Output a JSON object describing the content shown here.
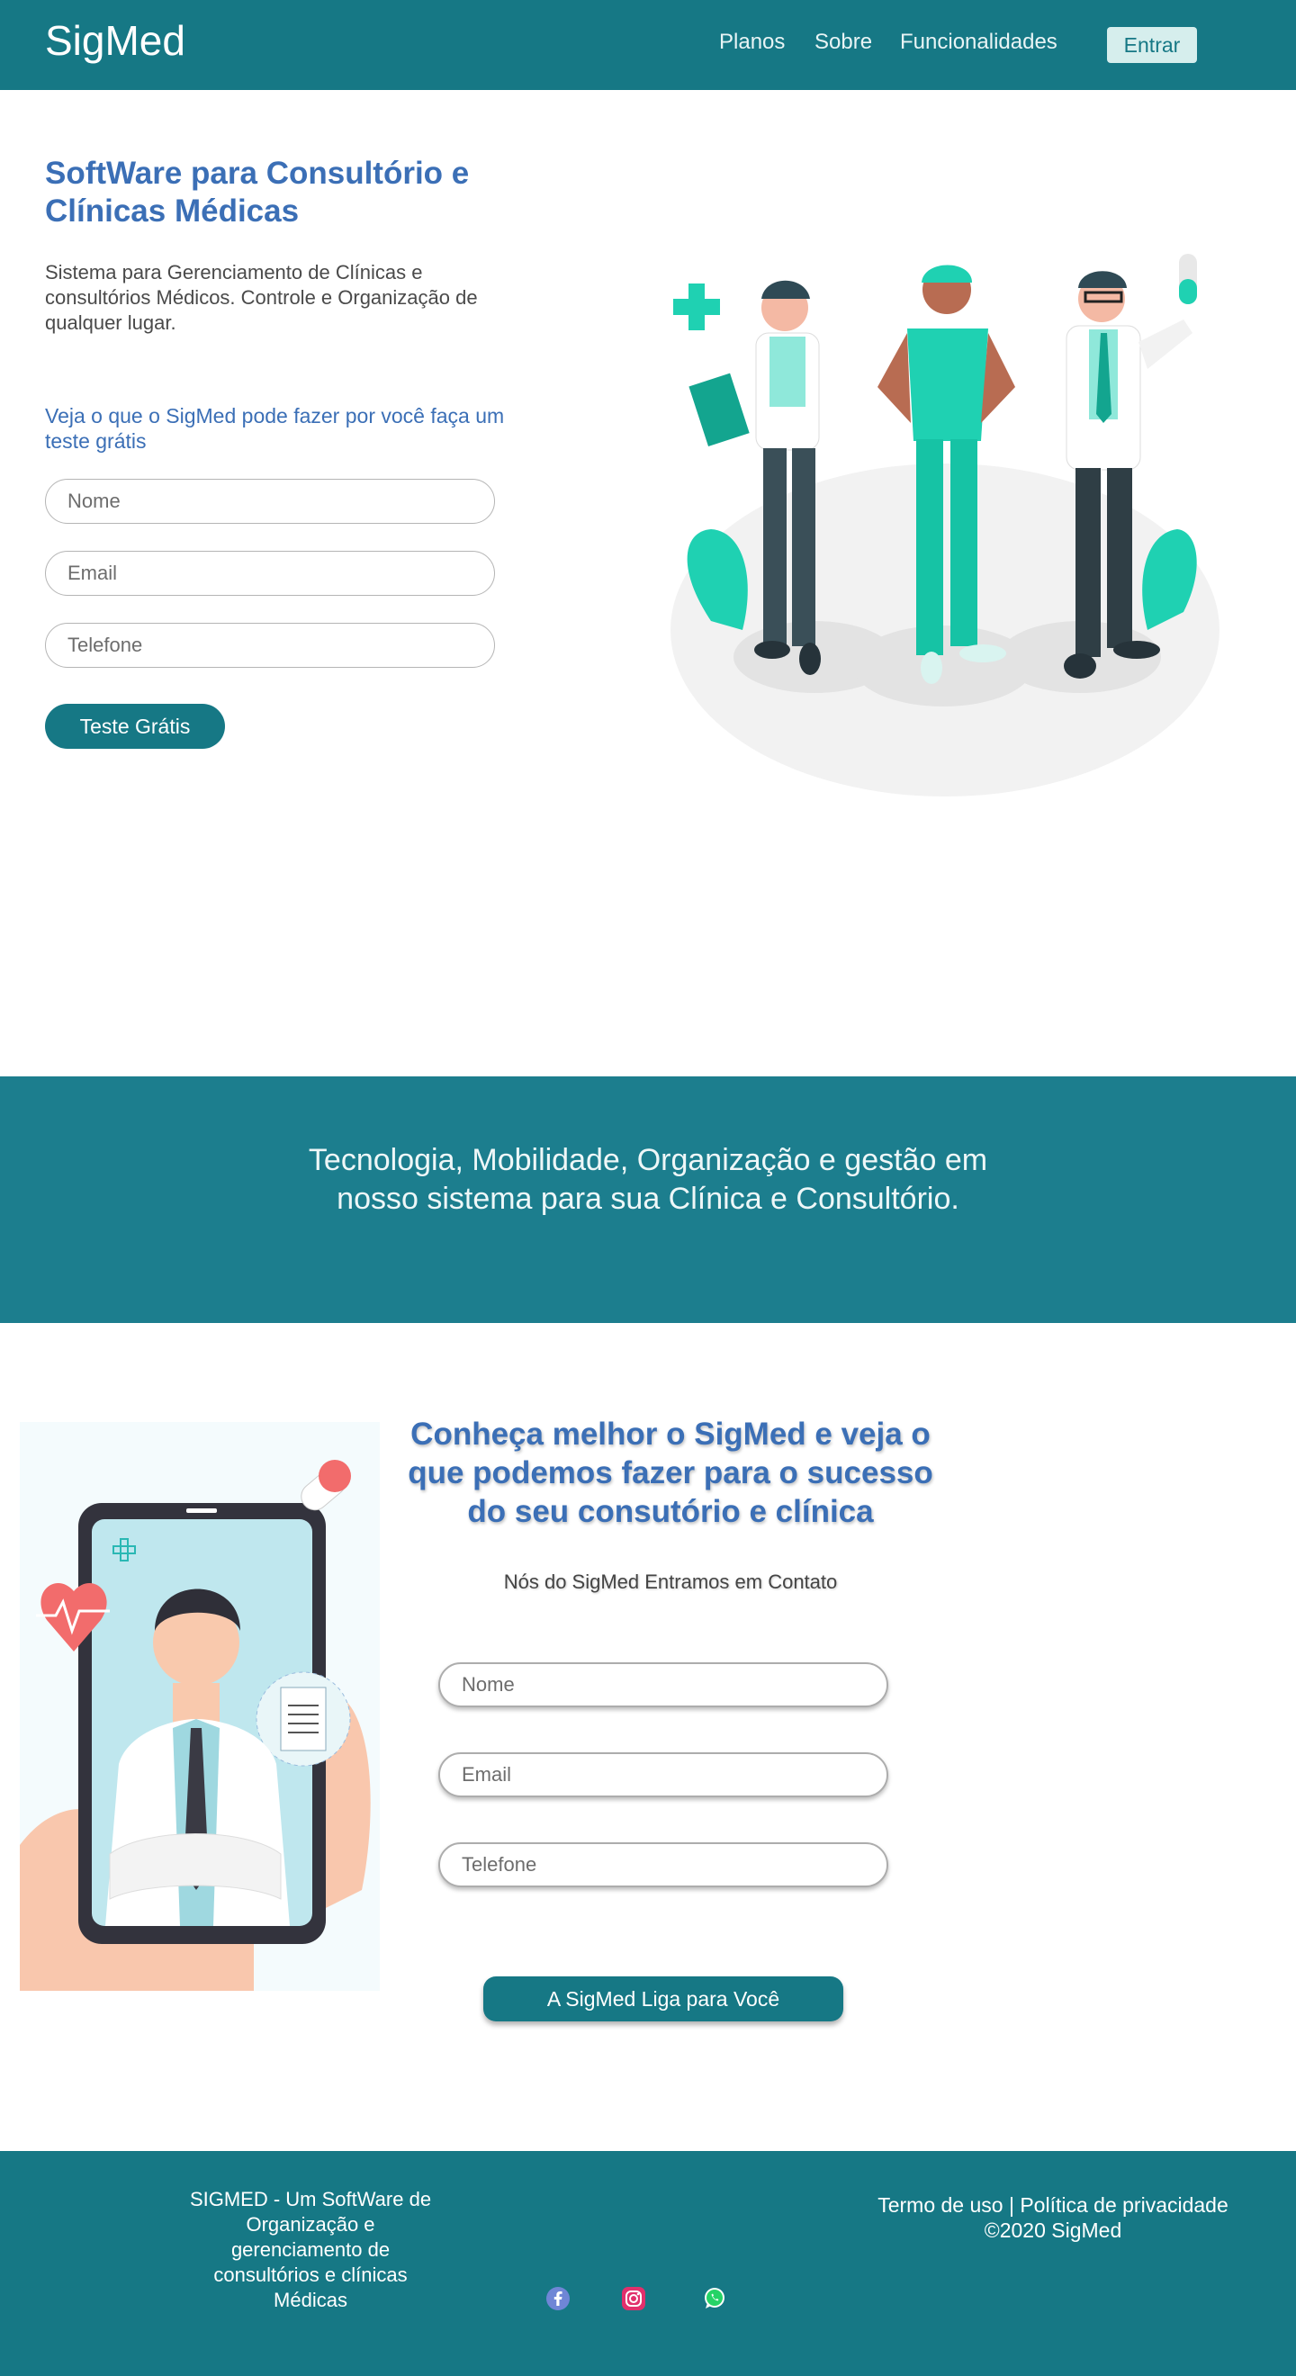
{
  "nav": {
    "brand": "SigMed",
    "links": [
      "Planos",
      "Sobre",
      "Funcionalidades"
    ],
    "login_label": "Entrar"
  },
  "hero": {
    "title": "SoftWare para Consultório e Clínicas Médicas",
    "description": "Sistema para Gerenciamento de Clínicas e consultórios Médicos.  Controle e Organização de qualquer lugar.",
    "cta_text": "Veja o que o SigMed pode fazer por você faça um teste grátis",
    "form": {
      "name_placeholder": "Nome",
      "email_placeholder": "Email",
      "phone_placeholder": "Telefone",
      "submit_label": "Teste Grátis"
    }
  },
  "banner": {
    "text": "Tecnologia, Mobilidade, Organização e gestão em nosso sistema para sua Clínica e Consultório."
  },
  "contact": {
    "title": "Conheça melhor o SigMed e veja o que podemos fazer para o sucesso do seu consutório e clínica",
    "subtitle": "Nós do SigMed Entramos em Contato",
    "form": {
      "name_placeholder": "Nome",
      "email_placeholder": "Email",
      "phone_placeholder": "Telefone",
      "submit_label": "A SigMed Liga para Você"
    }
  },
  "footer": {
    "about": "SIGMED - Um SoftWare de Organização e gerenciamento de consultórios e clínicas Médicas",
    "terms": "Termo de uso",
    "separator": "|",
    "privacy": "Política de privacidade",
    "copyright": "©2020 SigMed",
    "social_icons": [
      "facebook-icon",
      "instagram-icon",
      "whatsapp-icon"
    ]
  },
  "colors": {
    "primary": "#167885",
    "banner": "#1c7e8e",
    "heading_blue": "#3b6fb6",
    "accent_teal": "#1fd1b2"
  }
}
